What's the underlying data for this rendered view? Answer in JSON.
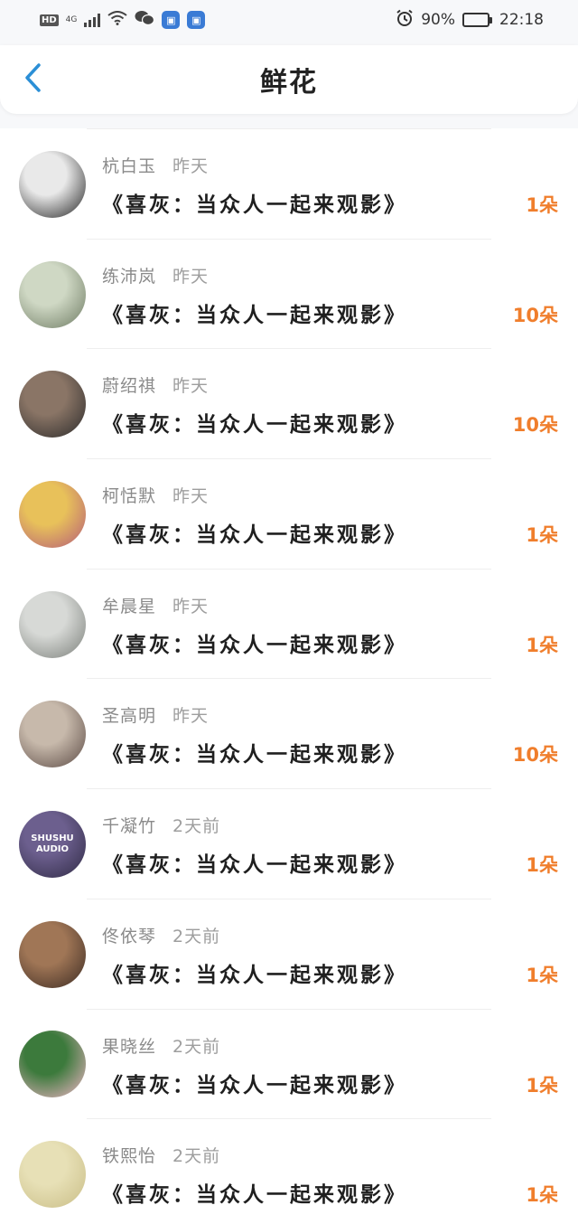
{
  "status_bar": {
    "hd": "HD",
    "net": "4G",
    "battery_pct": "90%",
    "battery_level": 0.9,
    "time": "22:18",
    "icons": [
      "signal-icon",
      "wifi-icon",
      "wechat-icon",
      "app-badge-icon",
      "app-badge-icon",
      "alarm-icon",
      "battery-icon"
    ]
  },
  "header": {
    "title": "鲜花",
    "back_icon": "chevron-left-icon"
  },
  "colors": {
    "accent_blue": "#2b8fd6",
    "count_orange": "#f07e2c"
  },
  "items": [
    {
      "name": "杭白玉",
      "time": "昨天",
      "title": "《喜灰：当众人一起来观影》",
      "count": "1朵",
      "avatar_colors": [
        "#e9e9e9",
        "#222222"
      ]
    },
    {
      "name": "练沛岚",
      "time": "昨天",
      "title": "《喜灰：当众人一起来观影》",
      "count": "10朵",
      "avatar_colors": [
        "#cfd8c4",
        "#6d7a62"
      ]
    },
    {
      "name": "蔚绍祺",
      "time": "昨天",
      "title": "《喜灰：当众人一起来观影》",
      "count": "10朵",
      "avatar_colors": [
        "#8a7566",
        "#2b2a2a"
      ]
    },
    {
      "name": "柯恬默",
      "time": "昨天",
      "title": "《喜灰：当众人一起来观影》",
      "count": "1朵",
      "avatar_colors": [
        "#e8c15a",
        "#b45a7a"
      ]
    },
    {
      "name": "牟晨星",
      "time": "昨天",
      "title": "《喜灰：当众人一起来观影》",
      "count": "1朵",
      "avatar_colors": [
        "#d7d9d6",
        "#7b7f7a"
      ]
    },
    {
      "name": "圣高明",
      "time": "昨天",
      "title": "《喜灰：当众人一起来观影》",
      "count": "10朵",
      "avatar_colors": [
        "#c7b9ab",
        "#5b4a44"
      ]
    },
    {
      "name": "千凝竹",
      "time": "2天前",
      "title": "《喜灰：当众人一起来观影》",
      "count": "1朵",
      "avatar_colors": [
        "#6c5f8e",
        "#2f2a44"
      ],
      "avatar_text": [
        "SHUSHU",
        "AUDIO"
      ]
    },
    {
      "name": "佟依琴",
      "time": "2天前",
      "title": "《喜灰：当众人一起来观影》",
      "count": "1朵",
      "avatar_colors": [
        "#a07656",
        "#3b2a22"
      ]
    },
    {
      "name": "果晓丝",
      "time": "2天前",
      "title": "《喜灰：当众人一起来观影》",
      "count": "1朵",
      "avatar_colors": [
        "#3c7a3c",
        "#f3b6c9"
      ]
    },
    {
      "name": "铁熙怡",
      "time": "2天前",
      "title": "《喜灰：当众人一起来观影》",
      "count": "1朵",
      "avatar_colors": [
        "#e7e0b6",
        "#c9bd86"
      ]
    }
  ]
}
